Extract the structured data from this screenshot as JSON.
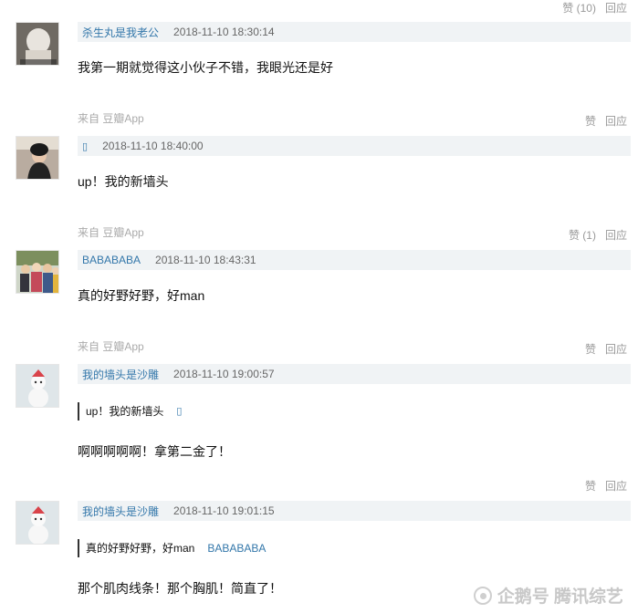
{
  "common": {
    "like_label": "赞",
    "reply_label": "回应",
    "source_label": "来自 豆瓣App",
    "user_icon": "▯"
  },
  "top_actions": {
    "like": "赞 (10)"
  },
  "comments": [
    {
      "user": "杀生丸是我老公",
      "time": "2018-11-10 18:30:14",
      "text": "我第一期就觉得这小伙子不错，我眼光还是好",
      "likes": "赞"
    },
    {
      "user": "",
      "time": "2018-11-10 18:40:00",
      "text": "up！我的新墙头",
      "likes": "赞 (1)"
    },
    {
      "user": "BABABABA",
      "time": "2018-11-10 18:43:31",
      "text": "真的好野好野，好man",
      "likes": "赞"
    },
    {
      "user": "我的墙头是沙雕",
      "time": "2018-11-10 19:00:57",
      "quote_text": "up！我的新墙头",
      "quote_user": "",
      "text": "啊啊啊啊啊！拿第二金了！",
      "likes": "赞"
    },
    {
      "user": "我的墙头是沙雕",
      "time": "2018-11-10 19:01:15",
      "quote_text": "真的好野好野，好man",
      "quote_user": "BABABABA",
      "text": "那个肌肉线条！那个胸肌！简直了！"
    }
  ],
  "watermark": {
    "text": "企鹅号 腾讯综艺"
  },
  "colors": {
    "link": "#3377aa",
    "meta_bg": "#f0f3f5",
    "muted": "#999999"
  }
}
